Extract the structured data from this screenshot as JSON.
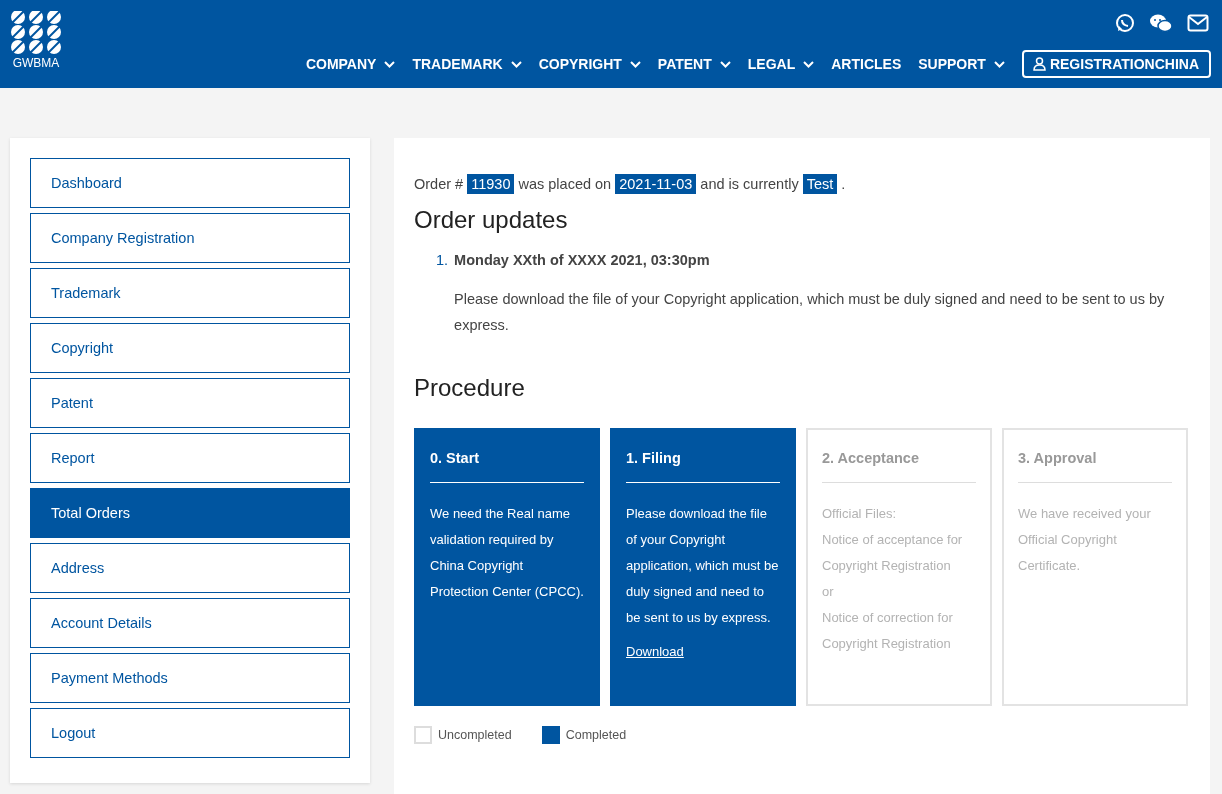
{
  "header": {
    "logo_text": "GWBMA",
    "nav": [
      {
        "label": "COMPANY",
        "dropdown": true
      },
      {
        "label": "TRADEMARK",
        "dropdown": true
      },
      {
        "label": "COPYRIGHT",
        "dropdown": true
      },
      {
        "label": "PATENT",
        "dropdown": true
      },
      {
        "label": "LEGAL",
        "dropdown": true
      },
      {
        "label": "ARTICLES",
        "dropdown": false
      },
      {
        "label": "SUPPORT",
        "dropdown": true
      }
    ],
    "account_button": "REGISTRATIONCHINA"
  },
  "sidebar": {
    "items": [
      {
        "label": "Dashboard",
        "selected": false
      },
      {
        "label": "Company Registration",
        "selected": false
      },
      {
        "label": "Trademark",
        "selected": false
      },
      {
        "label": "Copyright",
        "selected": false
      },
      {
        "label": "Patent",
        "selected": false
      },
      {
        "label": "Report",
        "selected": false
      },
      {
        "label": "Total Orders",
        "selected": true
      },
      {
        "label": "Address",
        "selected": false
      },
      {
        "label": "Account Details",
        "selected": false
      },
      {
        "label": "Payment Methods",
        "selected": false
      },
      {
        "label": "Logout",
        "selected": false
      }
    ]
  },
  "order_summary": [
    {
      "text": "Order #",
      "highlight": false
    },
    {
      "text": "11930",
      "highlight": true
    },
    {
      "text": "was placed on",
      "highlight": false
    },
    {
      "text": "2021-11-03",
      "highlight": true
    },
    {
      "text": "and is currently",
      "highlight": false
    },
    {
      "text": "Test",
      "highlight": true
    },
    {
      "text": ".",
      "highlight": false
    }
  ],
  "order_updates": {
    "title": "Order updates",
    "items": [
      {
        "number": "1.",
        "date": "Monday XXth of XXXX 2021, 03:30pm",
        "message": "Please download the file of your Copyright application, which must be duly signed and need to be sent to us by express."
      }
    ]
  },
  "procedure": {
    "title": "Procedure",
    "steps": [
      {
        "title": "0. Start",
        "completed": true,
        "paragraphs": [
          "We need the Real name validation required by China Copyright Protection Center (CPCC)."
        ]
      },
      {
        "title": "1. Filing",
        "completed": true,
        "paragraphs": [
          "Please download the file of your Copyright application, which must be duly signed and need to be sent to us by express."
        ],
        "link": "Download"
      },
      {
        "title": "2. Acceptance",
        "completed": false,
        "paragraphs": [
          "Official Files:",
          "Notice of acceptance for Copyright Registration",
          "or",
          "Notice of correction for Copyright Registration"
        ]
      },
      {
        "title": "3. Approval",
        "completed": false,
        "paragraphs": [
          "We have received your Official Copyright Certificate."
        ]
      }
    ],
    "legend": [
      {
        "label": "Uncompleted",
        "completed": false
      },
      {
        "label": "Completed",
        "completed": true
      }
    ]
  }
}
